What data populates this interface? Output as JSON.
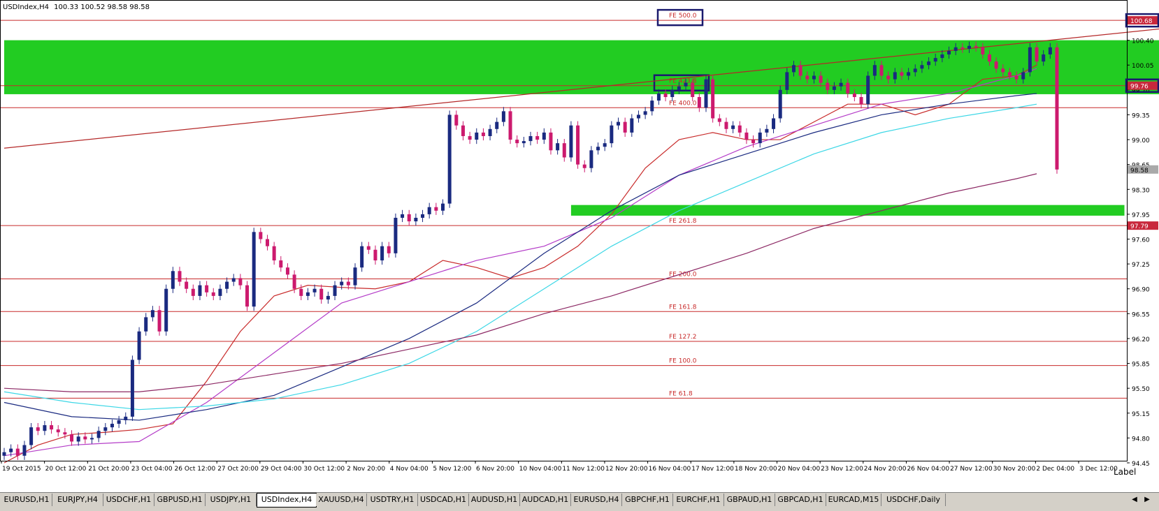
{
  "header": {
    "symbol": "USDIndex,H4",
    "ohlc": "100.33 100.52 98.58 98.58"
  },
  "watermark": "Label",
  "colors": {
    "bull": "#1a2a80",
    "bear": "#cc1a6e",
    "zone": "#22cc22",
    "fe_line": "#c82a2a",
    "box": "#1a1a6e",
    "ma_fast": "#c82a2a",
    "ma_mid": "#b43cc8",
    "ma_slow": "#1a2a80",
    "ma_cyan": "#3cd7e6",
    "ma_long": "#8c2864",
    "channel": "#b42828"
  },
  "tabs": [
    {
      "label": "EURUSD,H1"
    },
    {
      "label": "EURJPY,H4"
    },
    {
      "label": "USDCHF,H1"
    },
    {
      "label": "GBPUSD,H1"
    },
    {
      "label": "USDJPY,H1"
    },
    {
      "label": "USDIndex,H4",
      "active": true
    },
    {
      "label": "XAUUSD,H4"
    },
    {
      "label": "USDTRY,H1"
    },
    {
      "label": "USDCAD,H1"
    },
    {
      "label": "AUDUSD,H1"
    },
    {
      "label": "AUDCAD,H1"
    },
    {
      "label": "EURUSD,H4"
    },
    {
      "label": "GBPCHF,H1"
    },
    {
      "label": "EURCHF,H1"
    },
    {
      "label": "GBPAUD,H1"
    },
    {
      "label": "GBPCAD,H1"
    },
    {
      "label": "EURCAD,M15"
    },
    {
      "label": "USDCHF,Daily"
    }
  ],
  "chart_data": {
    "type": "candlestick",
    "symbol": "USDIndex",
    "timeframe": "H4",
    "ylim": [
      94.45,
      100.75
    ],
    "x_ticks": [
      "19 Oct 2015",
      "20 Oct 12:00",
      "21 Oct 20:00",
      "23 Oct 04:00",
      "26 Oct 12:00",
      "27 Oct 20:00",
      "29 Oct 04:00",
      "30 Oct 12:00",
      "2 Nov 20:00",
      "4 Nov 04:00",
      "5 Nov 12:00",
      "6 Nov 20:00",
      "10 Nov 04:00",
      "11 Nov 12:00",
      "12 Nov 20:00",
      "16 Nov 04:00",
      "17 Nov 12:00",
      "18 Nov 20:00",
      "20 Nov 04:00",
      "23 Nov 12:00",
      "24 Nov 20:00",
      "26 Nov 04:00",
      "27 Nov 12:00",
      "30 Nov 20:00",
      "2 Dec 04:00",
      "3 Dec 12:00"
    ],
    "y_ticks": [
      100.4,
      100.05,
      99.7,
      99.35,
      99.0,
      98.65,
      98.3,
      97.95,
      97.6,
      97.25,
      96.9,
      96.55,
      96.2,
      95.85,
      95.5,
      95.15,
      94.8,
      94.45
    ],
    "price_labels": [
      {
        "value": 100.68,
        "label": "100.68",
        "boxed": true
      },
      {
        "value": 99.76,
        "label": "99.76",
        "boxed": true
      },
      {
        "value": 98.58,
        "label": "98.58"
      },
      {
        "value": 97.79,
        "label": "97.79"
      }
    ],
    "fib_levels": [
      {
        "label": "FE 500.0",
        "value": 100.68,
        "boxed": true
      },
      {
        "label": "FE 423.8",
        "value": 99.76,
        "boxed": true
      },
      {
        "label": "FE 400.0",
        "value": 99.45
      },
      {
        "label": "FE 261.8",
        "value": 97.79
      },
      {
        "label": "FE 200.0",
        "value": 97.04
      },
      {
        "label": "FE 161.8",
        "value": 96.58
      },
      {
        "label": "FE 127.2",
        "value": 96.16
      },
      {
        "label": "FE 100.0",
        "value": 95.82
      },
      {
        "label": "FE 61.8",
        "value": 95.36
      }
    ],
    "zones": [
      {
        "from": 99.64,
        "to": 100.4,
        "x_start": 0,
        "x_end": 223
      },
      {
        "from": 97.93,
        "to": 98.08,
        "x_start": 84,
        "x_end": 166
      }
    ],
    "channel_line": {
      "x1": 0,
      "y1": 98.88,
      "x2": 207,
      "y2": 100.91
    },
    "closes": [
      94.6,
      94.65,
      94.55,
      94.7,
      94.95,
      94.9,
      94.98,
      94.92,
      94.88,
      94.85,
      94.75,
      94.82,
      94.78,
      94.8,
      94.9,
      94.95,
      95.0,
      95.05,
      95.1,
      95.9,
      96.3,
      96.5,
      96.6,
      96.3,
      96.9,
      97.15,
      97.0,
      96.9,
      96.8,
      96.95,
      96.85,
      96.8,
      96.9,
      97.0,
      97.05,
      96.95,
      96.65,
      97.7,
      97.6,
      97.5,
      97.3,
      97.2,
      97.1,
      96.9,
      96.8,
      96.85,
      96.9,
      96.75,
      96.8,
      96.95,
      97.0,
      96.95,
      97.2,
      97.5,
      97.45,
      97.3,
      97.5,
      97.4,
      97.9,
      97.95,
      97.85,
      97.9,
      97.95,
      98.05,
      98.0,
      98.1,
      99.35,
      99.2,
      99.05,
      99.0,
      99.1,
      99.05,
      99.15,
      99.25,
      99.4,
      99.0,
      98.95,
      98.98,
      99.05,
      99.0,
      99.1,
      98.85,
      98.95,
      98.75,
      99.2,
      98.65,
      98.6,
      98.85,
      98.9,
      98.95,
      99.2,
      99.25,
      99.1,
      99.3,
      99.35,
      99.4,
      99.55,
      99.65,
      99.6,
      99.7,
      99.75,
      99.8,
      99.6,
      99.45,
      99.85,
      99.3,
      99.25,
      99.15,
      99.2,
      99.1,
      99.0,
      98.95,
      99.1,
      99.15,
      99.3,
      99.7,
      99.95,
      100.05,
      99.9,
      99.85,
      99.9,
      99.8,
      99.7,
      99.75,
      99.8,
      99.65,
      99.6,
      99.5,
      99.9,
      100.05,
      99.9,
      99.85,
      99.95,
      99.9,
      99.95,
      100.0,
      100.05,
      100.1,
      100.15,
      100.2,
      100.25,
      100.3,
      100.28,
      100.32,
      100.3,
      100.2,
      100.1,
      100.0,
      99.95,
      99.9,
      99.85,
      99.95,
      100.3,
      100.1,
      100.2,
      100.3,
      98.58
    ],
    "series": [
      {
        "name": "MA fast",
        "x": [
          0,
          5,
          10,
          15,
          20,
          25,
          30,
          35,
          40,
          45,
          50,
          55,
          60,
          65,
          70,
          75,
          80,
          85,
          90,
          95,
          100,
          105,
          110,
          115,
          120,
          125,
          130,
          135,
          140,
          145,
          150,
          153
        ],
        "y": [
          94.45,
          94.7,
          94.85,
          94.88,
          94.92,
          95.0,
          95.6,
          96.3,
          96.8,
          96.95,
          96.92,
          96.9,
          97.0,
          97.3,
          97.2,
          97.05,
          97.2,
          97.5,
          97.95,
          98.6,
          99.0,
          99.1,
          99.0,
          99.0,
          99.25,
          99.5,
          99.5,
          99.35,
          99.5,
          99.85,
          99.9,
          100.05
        ]
      },
      {
        "name": "MA mid",
        "x": [
          0,
          10,
          20,
          30,
          40,
          50,
          60,
          70,
          80,
          90,
          100,
          110,
          120,
          130,
          140,
          150,
          153
        ],
        "y": [
          94.55,
          94.7,
          94.75,
          95.3,
          96.0,
          96.7,
          97.0,
          97.3,
          97.5,
          97.9,
          98.5,
          98.9,
          99.2,
          99.5,
          99.65,
          99.9,
          100.0
        ]
      },
      {
        "name": "MA slow",
        "x": [
          0,
          10,
          20,
          30,
          40,
          50,
          60,
          70,
          80,
          90,
          100,
          110,
          120,
          130,
          140,
          150,
          153
        ],
        "y": [
          95.3,
          95.1,
          95.05,
          95.2,
          95.4,
          95.8,
          96.2,
          96.7,
          97.4,
          98.0,
          98.5,
          98.8,
          99.1,
          99.35,
          99.5,
          99.62,
          99.65
        ]
      },
      {
        "name": "MA cyan",
        "x": [
          0,
          10,
          20,
          30,
          40,
          50,
          60,
          70,
          80,
          90,
          100,
          110,
          120,
          130,
          140,
          150,
          153
        ],
        "y": [
          95.45,
          95.3,
          95.2,
          95.25,
          95.35,
          95.55,
          95.85,
          96.3,
          96.9,
          97.5,
          98.0,
          98.4,
          98.8,
          99.1,
          99.3,
          99.45,
          99.5
        ]
      },
      {
        "name": "MA long",
        "x": [
          0,
          10,
          20,
          30,
          40,
          50,
          60,
          70,
          80,
          90,
          100,
          110,
          120,
          130,
          140,
          150,
          153
        ],
        "y": [
          95.5,
          95.45,
          95.45,
          95.55,
          95.7,
          95.85,
          96.05,
          96.25,
          96.55,
          96.8,
          97.1,
          97.4,
          97.75,
          98.0,
          98.25,
          98.45,
          98.52
        ]
      }
    ]
  }
}
